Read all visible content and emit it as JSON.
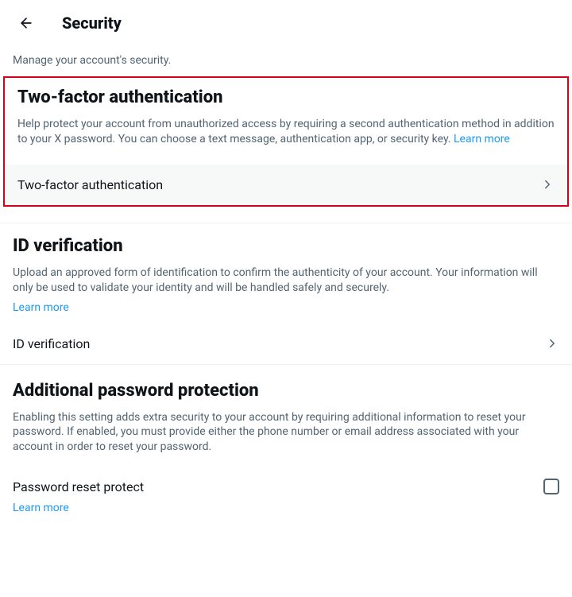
{
  "header": {
    "title": "Security"
  },
  "subtitle": "Manage your account's security.",
  "sections": {
    "two_factor": {
      "title": "Two-factor authentication",
      "desc": "Help protect your account from unauthorized access by requiring a second authentication method in addition to your X password. You can choose a text message, authentication app, or security key. ",
      "learn_more": "Learn more",
      "row_label": "Two-factor authentication"
    },
    "id_verify": {
      "title": "ID verification",
      "desc": "Upload an approved form of identification to confirm the authenticity of your account. Your information will only be used to validate your identity and will be handled safely and securely. ",
      "learn_more": "Learn more",
      "row_label": "ID verification"
    },
    "password_protect": {
      "title": "Additional password protection",
      "desc": "Enabling this setting adds extra security to your account by requiring additional information to reset your password. If enabled, you must provide either the phone number or email address associated with your account in order to reset your password.",
      "row_label": "Password reset protect",
      "learn_more": "Learn more"
    }
  }
}
